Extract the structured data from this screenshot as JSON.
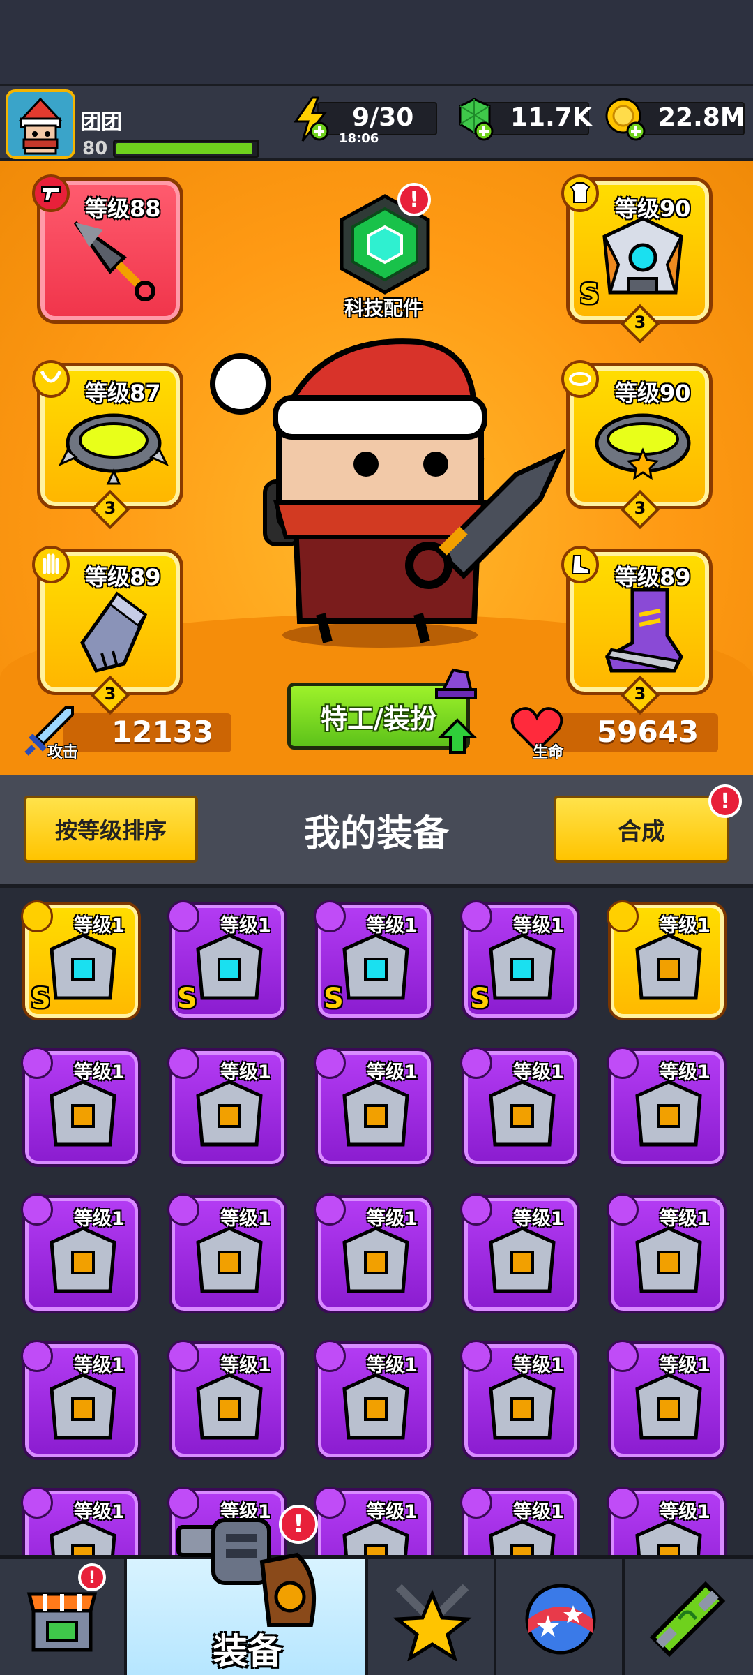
{
  "player": {
    "name": "团团",
    "level": "80"
  },
  "resources": {
    "energy": {
      "value": "9/30",
      "timer": "18:06"
    },
    "gems": {
      "value": "11.7K"
    },
    "coins": {
      "value": "22.8M"
    }
  },
  "hero": {
    "tech_label": "科技配件",
    "agent_button": "特工/装扮",
    "attack": {
      "label": "攻击",
      "value": "12133"
    },
    "health": {
      "label": "生命",
      "value": "59643"
    }
  },
  "slots": [
    {
      "level": "等级88",
      "stars": null
    },
    {
      "level": "等级90",
      "stars": "3"
    },
    {
      "level": "等级87",
      "stars": "3"
    },
    {
      "level": "等级90",
      "stars": "3"
    },
    {
      "level": "等级89",
      "stars": "3"
    },
    {
      "level": "等级89",
      "stars": "3"
    }
  ],
  "section": {
    "sort_button": "按等级排序",
    "title": "我的装备",
    "combine_button": "合成"
  },
  "items": [
    {
      "level": "等级1",
      "s": "S"
    },
    {
      "level": "等级1",
      "s": "S"
    },
    {
      "level": "等级1",
      "s": "S"
    },
    {
      "level": "等级1",
      "s": "S"
    },
    {
      "level": "等级1"
    },
    {
      "level": "等级1"
    },
    {
      "level": "等级1"
    },
    {
      "level": "等级1"
    },
    {
      "level": "等级1"
    },
    {
      "level": "等级1"
    },
    {
      "level": "等级1"
    },
    {
      "level": "等级1"
    },
    {
      "level": "等级1"
    },
    {
      "level": "等级1"
    },
    {
      "level": "等级1"
    },
    {
      "level": "等级1"
    },
    {
      "level": "等级1"
    },
    {
      "level": "等级1"
    },
    {
      "level": "等级1"
    },
    {
      "level": "等级1"
    },
    {
      "level": "等级1"
    },
    {
      "level": "等级1"
    },
    {
      "level": "等级1"
    },
    {
      "level": "等级1"
    },
    {
      "level": "等级1"
    }
  ],
  "nav": {
    "active_label": "装备"
  },
  "alerts": {
    "mark": "!"
  }
}
